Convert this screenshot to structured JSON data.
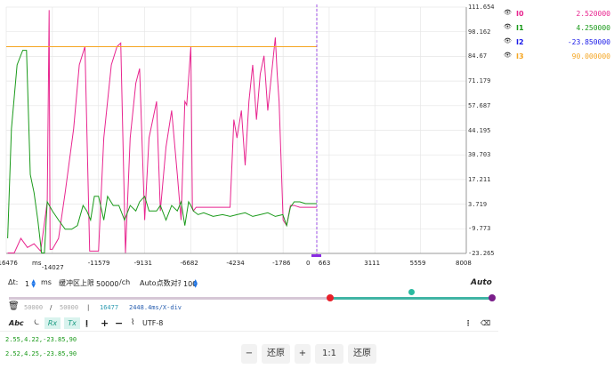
{
  "chart_data": {
    "type": "line",
    "y_ticks": [
      "111.654",
      "98.162",
      "84.67",
      "71.179",
      "57.687",
      "44.195",
      "30.703",
      "17.211",
      "3.719",
      "-9.773",
      "-23.265"
    ],
    "x_ticks_left": [
      "-16476",
      "-14027",
      "-11579",
      "-9131",
      "-6682",
      "-4234",
      "-1786"
    ],
    "x_ticks_right": [
      "0",
      "663",
      "3111",
      "5559",
      "8008"
    ],
    "x_unit": "ms",
    "series": [
      {
        "name": "I0",
        "color": "#e8258f",
        "points": [
          [
            -16400,
            -23
          ],
          [
            -16050,
            -23
          ],
          [
            -15700,
            -15
          ],
          [
            -15350,
            -20
          ],
          [
            -15000,
            -18
          ],
          [
            -14650,
            -22
          ],
          [
            -14300,
            5
          ],
          [
            -14200,
            110
          ],
          [
            -14150,
            -21
          ],
          [
            -14027,
            -21
          ],
          [
            -13700,
            -15
          ],
          [
            -13350,
            10
          ],
          [
            -12900,
            45
          ],
          [
            -12600,
            80
          ],
          [
            -12300,
            90
          ],
          [
            -12050,
            -22
          ],
          [
            -11579,
            -22
          ],
          [
            -11300,
            40
          ],
          [
            -10900,
            80
          ],
          [
            -10600,
            90
          ],
          [
            -10400,
            92
          ],
          [
            -10150,
            -23
          ],
          [
            -9900,
            40
          ],
          [
            -9600,
            70
          ],
          [
            -9400,
            78
          ],
          [
            -9131,
            -5
          ],
          [
            -8900,
            40
          ],
          [
            -8500,
            60
          ],
          [
            -8300,
            0
          ],
          [
            -8000,
            35
          ],
          [
            -7700,
            55
          ],
          [
            -7400,
            20
          ],
          [
            -7200,
            -5
          ],
          [
            -7000,
            60
          ],
          [
            -6900,
            58
          ],
          [
            -6682,
            90
          ],
          [
            -6600,
            2
          ],
          [
            -6550,
            0
          ],
          [
            -6400,
            2
          ],
          [
            -6000,
            2
          ],
          [
            -5500,
            2
          ],
          [
            -5000,
            2
          ],
          [
            -4600,
            2
          ],
          [
            -4400,
            50
          ],
          [
            -4234,
            40
          ],
          [
            -4000,
            55
          ],
          [
            -3800,
            25
          ],
          [
            -3600,
            60
          ],
          [
            -3400,
            80
          ],
          [
            -3200,
            50
          ],
          [
            -3000,
            75
          ],
          [
            -2800,
            85
          ],
          [
            -2600,
            55
          ],
          [
            -2400,
            75
          ],
          [
            -2200,
            95
          ],
          [
            -2100,
            75
          ],
          [
            -2000,
            60
          ],
          [
            -1786,
            -5
          ],
          [
            -1600,
            -8
          ],
          [
            -1400,
            3
          ],
          [
            -1200,
            3
          ],
          [
            -900,
            2
          ],
          [
            -600,
            2
          ],
          [
            -300,
            2
          ],
          [
            0,
            2
          ]
        ]
      },
      {
        "name": "I1",
        "color": "#1a9a1a",
        "points": [
          [
            -16400,
            -15
          ],
          [
            -16200,
            45
          ],
          [
            -15900,
            80
          ],
          [
            -15600,
            88
          ],
          [
            -15400,
            88
          ],
          [
            -15200,
            20
          ],
          [
            -15000,
            10
          ],
          [
            -14800,
            -5
          ],
          [
            -14600,
            -23
          ],
          [
            -14450,
            -23
          ],
          [
            -14300,
            5
          ],
          [
            -14027,
            0
          ],
          [
            -13700,
            -5
          ],
          [
            -13350,
            -10
          ],
          [
            -13000,
            -10
          ],
          [
            -12700,
            -8
          ],
          [
            -12400,
            3
          ],
          [
            -12200,
            0
          ],
          [
            -12000,
            -5
          ],
          [
            -11800,
            8
          ],
          [
            -11579,
            8
          ],
          [
            -11300,
            -5
          ],
          [
            -11100,
            8
          ],
          [
            -10800,
            3
          ],
          [
            -10500,
            3
          ],
          [
            -10200,
            -5
          ],
          [
            -9900,
            3
          ],
          [
            -9600,
            0
          ],
          [
            -9400,
            5
          ],
          [
            -9131,
            8
          ],
          [
            -8900,
            0
          ],
          [
            -8500,
            0
          ],
          [
            -8300,
            3
          ],
          [
            -8000,
            -5
          ],
          [
            -7700,
            3
          ],
          [
            -7400,
            0
          ],
          [
            -7200,
            5
          ],
          [
            -7000,
            -8
          ],
          [
            -6800,
            5
          ],
          [
            -6682,
            3
          ],
          [
            -6550,
            0
          ],
          [
            -6300,
            -2
          ],
          [
            -6000,
            -1
          ],
          [
            -5500,
            -3
          ],
          [
            -5000,
            -2
          ],
          [
            -4600,
            -3
          ],
          [
            -4234,
            -2
          ],
          [
            -3800,
            -1
          ],
          [
            -3400,
            -3
          ],
          [
            -3000,
            -2
          ],
          [
            -2600,
            -1
          ],
          [
            -2200,
            -3
          ],
          [
            -1800,
            -2
          ],
          [
            -1600,
            -8
          ],
          [
            -1400,
            2
          ],
          [
            -1200,
            5
          ],
          [
            -900,
            5
          ],
          [
            -600,
            4
          ],
          [
            0,
            4
          ]
        ]
      },
      {
        "name": "I3",
        "color": "#f5a623",
        "points": [
          [
            -16476,
            90
          ],
          [
            0,
            90
          ]
        ]
      }
    ],
    "ylim": [
      -23.265,
      111.654
    ],
    "xlim": [
      -16476,
      8008
    ]
  },
  "legend": [
    {
      "name": "I0",
      "value": "2.520000",
      "color": "#e8258f"
    },
    {
      "name": "I1",
      "value": "4.250000",
      "color": "#1a9a1a"
    },
    {
      "name": "I2",
      "value": "-23.850000",
      "color": "#1a1ae8"
    },
    {
      "name": "I3",
      "value": "90.000000",
      "color": "#f5a623"
    }
  ],
  "controls": {
    "dt_label": "Δt:",
    "dt_value": "1",
    "dt_unit": "ms",
    "buffer_label": "缓冲区上限:",
    "buffer_value": "50000",
    "buffer_unit": "/ch",
    "auto_align_label": "Auto点数对齐:",
    "auto_align_value": "100",
    "auto_label": "Auto"
  },
  "status": {
    "count_a": "50000",
    "slash": "/",
    "count_b": "50000",
    "sep": "|",
    "points": "16477",
    "rate": "2448.4ms/X-div"
  },
  "toolbar": {
    "abc": "Abc",
    "rx": "Rx",
    "tx": "Tx",
    "encoding": "UTF-8"
  },
  "received": [
    "2.55,4.22,-23.85,90",
    "2.52,4.25,-23.85,90"
  ],
  "buttons": {
    "minus": "−",
    "restore1": "还原",
    "plus": "+",
    "ratio": "1:1",
    "restore2": "还原"
  }
}
